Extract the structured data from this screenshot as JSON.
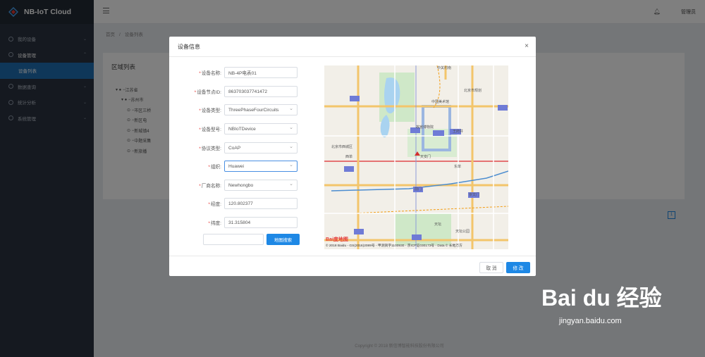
{
  "app": {
    "title": "NB-IoT Cloud"
  },
  "sidebar": {
    "items": [
      {
        "label": "我的设备",
        "arrow": "⌄"
      },
      {
        "label": "设备管理",
        "arrow": "⌃"
      },
      {
        "label": "设备列表",
        "arrow": ""
      },
      {
        "label": "数据查询",
        "arrow": "⌄"
      },
      {
        "label": "统计分析",
        "arrow": "⌄"
      },
      {
        "label": "系统管理",
        "arrow": "⌄"
      }
    ]
  },
  "topbar": {
    "user": "管理员"
  },
  "breadcrumb": [
    "首页",
    "/",
    "设备列表"
  ],
  "panel": {
    "title": "区域列表",
    "tree": [
      "江苏省",
      "苏州市",
      "市区三桥",
      "新区电",
      "新城镇4",
      "中题采集",
      "新旅播"
    ]
  },
  "pagination": {
    "current": "1"
  },
  "footer": {
    "copyright": "Copyright © 2018 新信博智能科技股份有限公司"
  },
  "modal": {
    "title": "设备信息",
    "close": "×",
    "fields": [
      {
        "label": "设备名称:",
        "value": "NB-4P电表01"
      },
      {
        "label": "设备节点ID:",
        "value": "863703037741472"
      },
      {
        "label": "设备类型:",
        "value": "ThreePhaseFourCircuits"
      },
      {
        "label": "设备型号:",
        "value": "NBIoTDevice"
      },
      {
        "label": "协议类型:",
        "value": "CoAP"
      },
      {
        "label": "组织:",
        "value": "Huawei"
      },
      {
        "label": "厂商名称:",
        "value": "Newhongbo"
      },
      {
        "label": "经度:",
        "value": "120.802377"
      },
      {
        "label": "纬度:",
        "value": "31.315804"
      }
    ],
    "search_button": "地图搜索",
    "cancel_button": "取 消",
    "ok_button": "修 改"
  },
  "map": {
    "attribution": "© 2018 Baidu - GS(2016)2089号 - 甲测资字1100930 - 京ICP证030173号 - Data © 长地万方",
    "logo": "Bai度地图",
    "labels": [
      "中关村南",
      "北京市规划",
      "北京市西城区",
      "中国美术馆",
      "故宫博物院",
      "西单",
      "天安门",
      "王府井",
      "东单",
      "前门",
      "崇文门",
      "天坛",
      "天坛公园"
    ]
  },
  "watermark": {
    "brand": "Bai du 经验",
    "url": "jingyan.baidu.com"
  }
}
